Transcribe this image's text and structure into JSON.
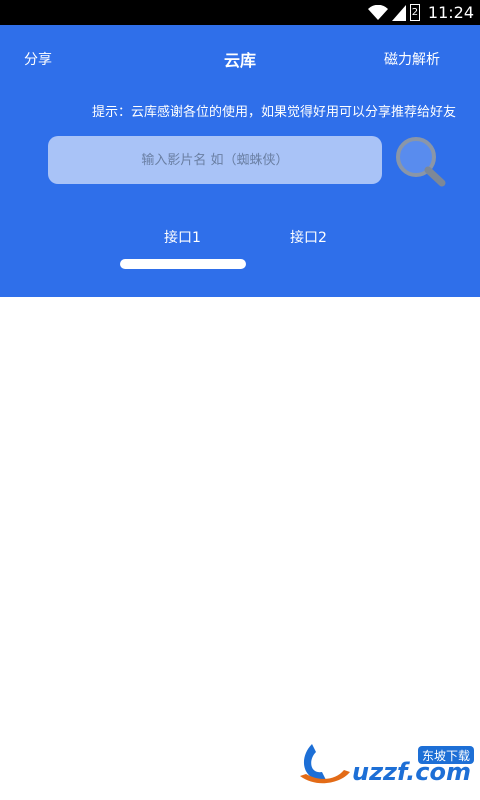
{
  "status_bar": {
    "time": "11:24",
    "battery_level": "2",
    "icons": [
      "wifi-icon",
      "signal-icon",
      "battery-icon"
    ]
  },
  "header": {
    "share_label": "分享",
    "title": "云库",
    "magnet_label": "磁力解析"
  },
  "hint": {
    "text": "提示：云库感谢各位的使用，如果觉得好用可以分享推荐给好友"
  },
  "search": {
    "placeholder": "输入影片名 如（蜘蛛侠）",
    "value": "",
    "button_icon": "search-icon"
  },
  "tabs": [
    {
      "label": "接口1",
      "selected": true
    },
    {
      "label": "接口2",
      "selected": false
    }
  ],
  "watermark": {
    "text": "uzzf.com",
    "subtext": "东坡下载"
  },
  "colors": {
    "header_bg": "#2f6fea",
    "search_bg": "#a9c3f7",
    "status_bar_bg": "#000000"
  }
}
